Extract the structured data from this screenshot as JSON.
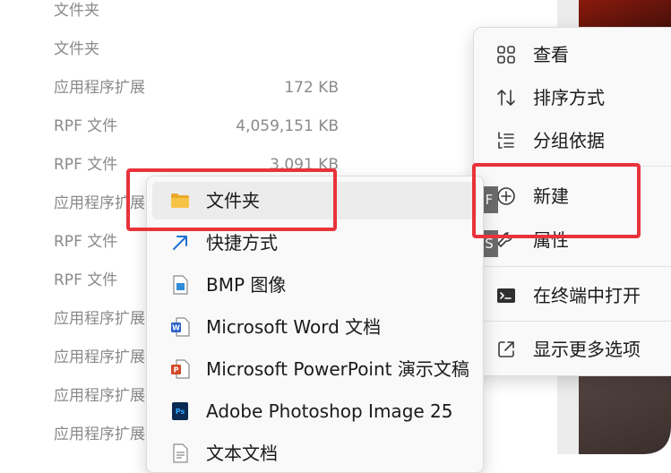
{
  "file_list": {
    "rows": [
      {
        "type": "文件夹",
        "size": ""
      },
      {
        "type": "文件夹",
        "size": ""
      },
      {
        "type": "应用程序扩展",
        "size": "172 KB"
      },
      {
        "type": "RPF 文件",
        "size": "4,059,151 KB"
      },
      {
        "type": "RPF 文件",
        "size": "3,091 KB"
      },
      {
        "type": "应用程序扩展",
        "size": ""
      },
      {
        "type": "RPF 文件",
        "size": ""
      },
      {
        "type": "RPF 文件",
        "size": ""
      },
      {
        "type": "应用程序扩展",
        "size": ""
      },
      {
        "type": "应用程序扩展",
        "size": ""
      },
      {
        "type": "应用程序扩展",
        "size": ""
      },
      {
        "type": "应用程序扩展",
        "size": ""
      }
    ]
  },
  "context_menu": {
    "items": [
      {
        "label": "查看",
        "icon": "grid-view-icon"
      },
      {
        "label": "排序方式",
        "icon": "sort-arrows-icon"
      },
      {
        "label": "分组依据",
        "icon": "group-list-icon"
      },
      {
        "label": "新建",
        "icon": "new-plus-icon",
        "shortcut": "F"
      },
      {
        "label": "属性",
        "icon": "properties-wrench-icon",
        "shortcut": "S"
      },
      {
        "label": "在终端中打开",
        "icon": "terminal-icon"
      },
      {
        "label": "显示更多选项",
        "icon": "more-options-icon"
      }
    ]
  },
  "new_submenu": {
    "items": [
      {
        "label": "文件夹",
        "icon": "folder-icon"
      },
      {
        "label": "快捷方式",
        "icon": "shortcut-arrow-icon"
      },
      {
        "label": "BMP 图像",
        "icon": "bmp-image-icon"
      },
      {
        "label": "Microsoft Word 文档",
        "icon": "word-document-icon"
      },
      {
        "label": "Microsoft PowerPoint 演示文稿",
        "icon": "powerpoint-document-icon"
      },
      {
        "label": "Adobe Photoshop Image 25",
        "icon": "photoshop-document-icon"
      },
      {
        "label": "文本文档",
        "icon": "text-document-icon"
      }
    ]
  },
  "colors": {
    "highlight": "#e8333a",
    "folder": "#f6c346",
    "word": "#2b5fc7",
    "powerpoint": "#d24726",
    "photoshop": "#0a2a52",
    "accent_blue": "#1f6fd1"
  }
}
